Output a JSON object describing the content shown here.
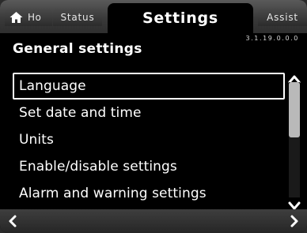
{
  "header": {
    "tabs": {
      "home": "Ho",
      "status": "Status",
      "settings": "Settings",
      "assist": "Assist"
    },
    "version": "3.1.19.0.0.0"
  },
  "page": {
    "title": "General settings"
  },
  "menu": {
    "items": [
      {
        "label": "Language",
        "selected": true
      },
      {
        "label": "Set date and time",
        "selected": false
      },
      {
        "label": "Units",
        "selected": false
      },
      {
        "label": "Enable/disable settings",
        "selected": false
      },
      {
        "label": "Alarm and warning settings",
        "selected": false
      }
    ]
  },
  "scroll": {
    "thumb_fraction": 0.48
  },
  "icons": {
    "home": "home-icon",
    "scroll_up": "chevron-up-icon",
    "scroll_down": "chevron-down-icon",
    "back": "chevron-left-icon",
    "forward": "chevron-right-icon"
  },
  "colors": {
    "background": "#000000",
    "text": "#ffffff",
    "scroll_thumb": "#b9b9b9"
  }
}
